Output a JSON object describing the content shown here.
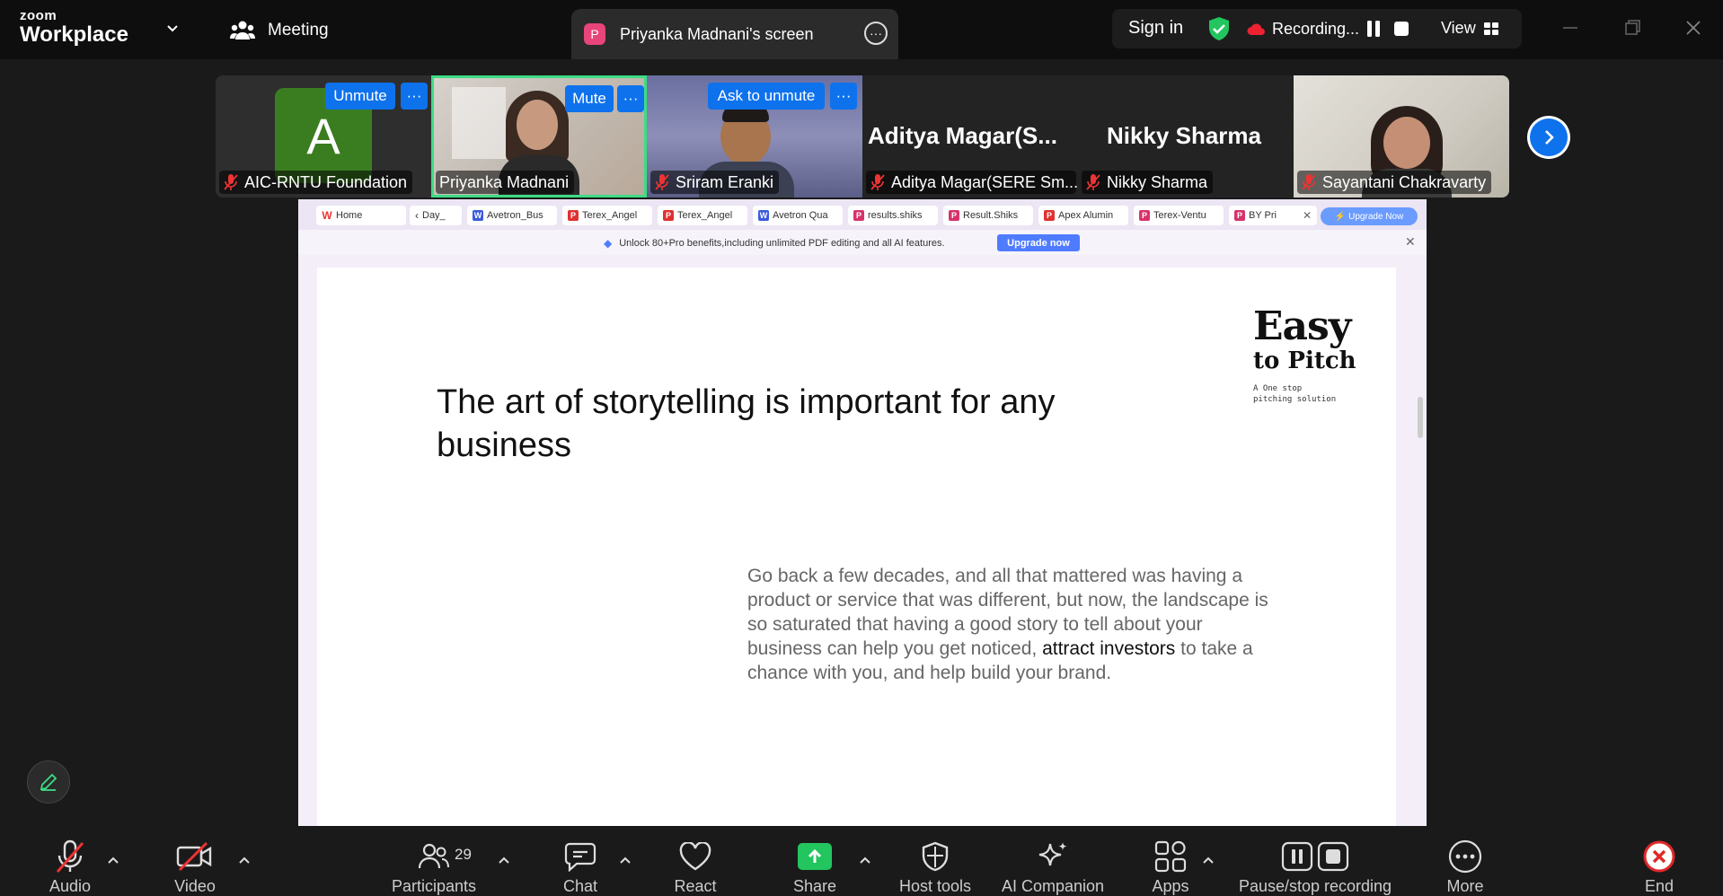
{
  "topbar": {
    "brand_small": "zoom",
    "brand_big": "Workplace",
    "meeting_label": "Meeting",
    "screen_badge": "P",
    "screen_tab_label": "Priyanka Madnani's screen",
    "sign_in": "Sign in",
    "recording_label": "Recording...",
    "view_label": "View"
  },
  "participants_strip": [
    {
      "name": "AIC-RNTU Foundation",
      "avatar_letter": "A",
      "button": "Unmute",
      "more": "···"
    },
    {
      "name": "Priyanka Madnani",
      "button": "Mute",
      "more": "···",
      "active_speaker": true
    },
    {
      "name": "Sriram Eranki",
      "button": "Ask to unmute",
      "more": "···"
    },
    {
      "name": "Aditya Magar(SERE Sm...",
      "display_name": "Aditya  Magar(S..."
    },
    {
      "name": "Nikky Sharma",
      "display_name": "Nikky Sharma"
    },
    {
      "name": "Sayantani Chakravarty"
    }
  ],
  "shared_screen": {
    "tabs": [
      {
        "label": "Home",
        "icon": "W",
        "color": "#e33"
      },
      {
        "label": "Day_",
        "icon": "",
        "color": "#999"
      },
      {
        "label": "Avetron_Bus",
        "icon": "W",
        "color": "#3b5bdb"
      },
      {
        "label": "Terex_Angel",
        "icon": "P",
        "color": "#e03131"
      },
      {
        "label": "Terex_Angel",
        "icon": "P",
        "color": "#e03131"
      },
      {
        "label": "Avetron Qua",
        "icon": "W",
        "color": "#3b5bdb"
      },
      {
        "label": "results.shiks",
        "icon": "P",
        "color": "#d6336c"
      },
      {
        "label": "Result.Shiks",
        "icon": "P",
        "color": "#d6336c"
      },
      {
        "label": "Apex Alumin",
        "icon": "P",
        "color": "#e03131"
      },
      {
        "label": "Terex-Ventu",
        "icon": "P",
        "color": "#d6336c"
      },
      {
        "label": "BY Pri",
        "icon": "P",
        "color": "#d6336c"
      }
    ],
    "upgrade_pill": "Upgrade Now",
    "promo_text": "Unlock 80+Pro benefits,including unlimited PDF editing and all AI features.",
    "promo_button": "Upgrade now",
    "slide": {
      "brand_line1": "Easy",
      "brand_line2": "to Pitch",
      "brand_tagline": "A One stop\npitching solution",
      "title": "The art of storytelling is important for any business",
      "body_part1": "Go back a few decades, and all that mattered was having a product or service that was different, but now, the landscape is so saturated that having a good story to tell about your business can help you get noticed, ",
      "body_bold": "attract investors",
      "body_part2": " to take a chance with you, and help build your brand."
    }
  },
  "toolbar": {
    "audio": "Audio",
    "video": "Video",
    "participants": "Participants",
    "participants_count": "29",
    "chat": "Chat",
    "react": "React",
    "share": "Share",
    "host_tools": "Host tools",
    "ai_companion": "AI Companion",
    "apps": "Apps",
    "pause_stop": "Pause/stop recording",
    "more": "More",
    "end": "End"
  },
  "colors": {
    "accent_blue": "#0e72ed",
    "share_green": "#22c55e",
    "active_border": "#3ddc84",
    "end_red": "#e02828"
  }
}
